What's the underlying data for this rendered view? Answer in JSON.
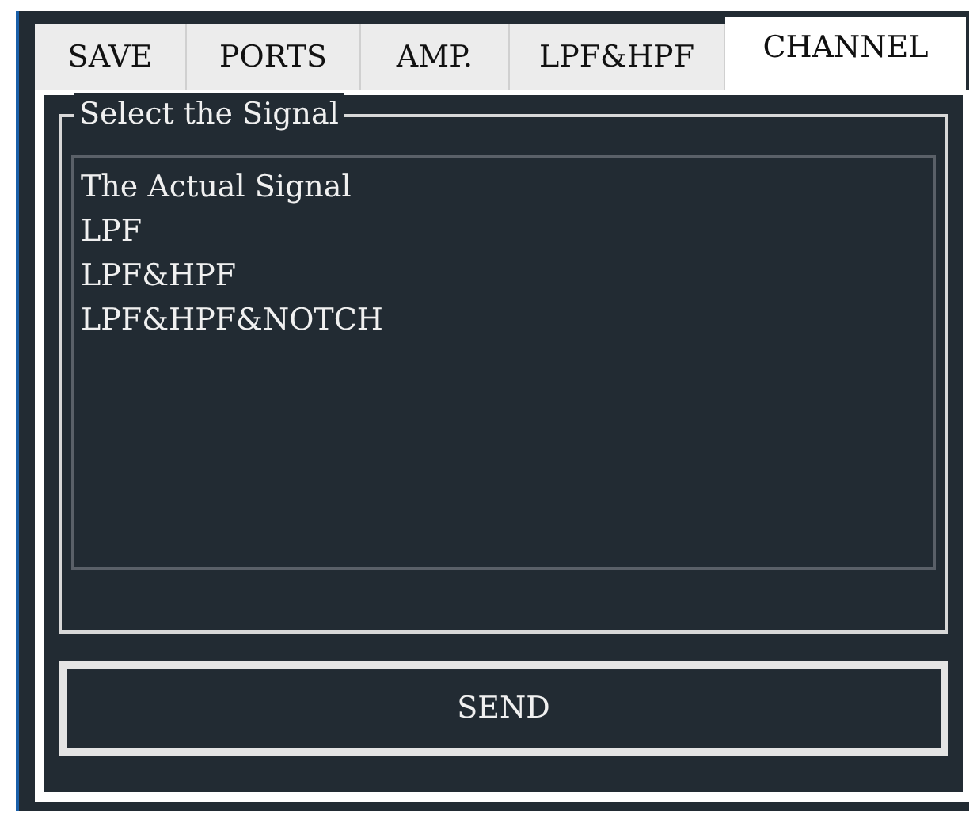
{
  "tabs": [
    {
      "label": "SAVE",
      "selected": false
    },
    {
      "label": "PORTS",
      "selected": false
    },
    {
      "label": "AMP.",
      "selected": false
    },
    {
      "label": "LPF&HPF",
      "selected": false
    },
    {
      "label": "CHANNEL",
      "selected": true
    }
  ],
  "group": {
    "title": "Select the Signal"
  },
  "signals": [
    {
      "label": "The Actual Signal"
    },
    {
      "label": "LPF"
    },
    {
      "label": "LPF&HPF"
    },
    {
      "label": "LPF&HPF&NOTCH"
    }
  ],
  "send_button": {
    "label": "SEND"
  }
}
